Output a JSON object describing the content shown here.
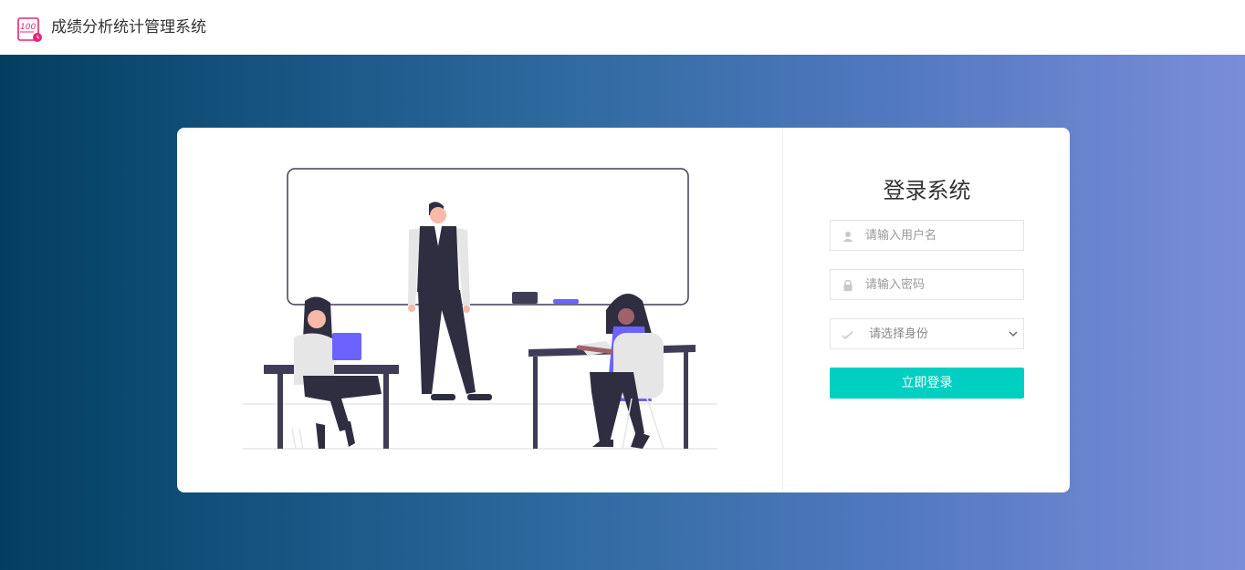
{
  "app": {
    "title": "成绩分析统计管理系统",
    "logo_text": "100"
  },
  "login": {
    "title": "登录系统",
    "username_placeholder": "请输入用户名",
    "password_placeholder": "请输入密码",
    "role_select": {
      "selected": "请选择身份",
      "options": [
        "请选择身份"
      ]
    },
    "submit_label": "立即登录"
  },
  "colors": {
    "accent": "#00cfc1",
    "logo": "#e8247a",
    "gradient_start": "#023f5f",
    "gradient_end": "#7a8dd8"
  },
  "icons": {
    "logo": "score-100-icon",
    "username": "user-icon",
    "password": "lock-icon",
    "role": "check-icon",
    "select": "chevron-down-icon"
  }
}
